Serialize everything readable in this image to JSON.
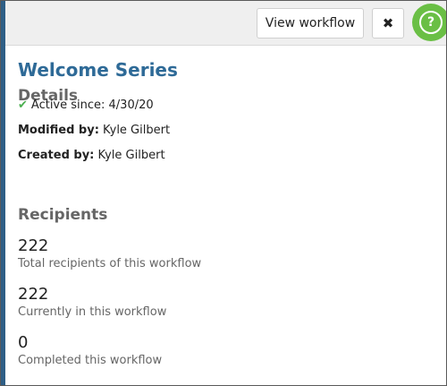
{
  "toolbar": {
    "view_workflow_label": "View workflow",
    "close_label": "✖",
    "help_label": "?"
  },
  "workflow": {
    "title": "Welcome Series"
  },
  "details": {
    "heading": "Details",
    "active_since": "Active since: 4/30/20",
    "modified_by_label": "Modified by:",
    "modified_by_value": "Kyle Gilbert",
    "created_by_label": "Created by:",
    "created_by_value": "Kyle Gilbert"
  },
  "recipients": {
    "heading": "Recipients",
    "stats": [
      {
        "value": "222",
        "label": "Total recipients of this workflow"
      },
      {
        "value": "222",
        "label": "Currently in this workflow"
      },
      {
        "value": "0",
        "label": "Completed this workflow"
      }
    ]
  },
  "colors": {
    "accent_bar": "#2f5f86",
    "title": "#2e6a97",
    "help_button": "#6abf45",
    "check": "#4caf50"
  }
}
